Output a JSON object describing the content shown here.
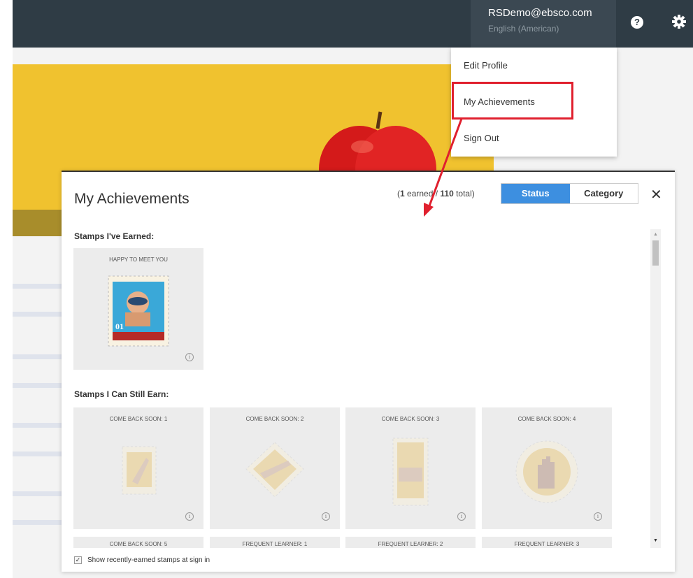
{
  "header": {
    "email": "RSDemo@ebsco.com",
    "language": "English (American)"
  },
  "menu": {
    "items": [
      "Edit Profile",
      "My Achievements",
      "Sign Out"
    ]
  },
  "modal": {
    "title": "My Achievements",
    "earned_count": "1",
    "earned_label": " earned / ",
    "total_count": "110",
    "total_label": " total)",
    "open_paren": "(",
    "tabs": [
      "Status",
      "Category"
    ],
    "close": "✕",
    "earned_heading": "Stamps I've Earned:",
    "earned_stamps": [
      {
        "title": "HAPPY TO MEET YOU",
        "number": "01"
      }
    ],
    "can_earn_heading": "Stamps I Can Still Earn:",
    "available_stamps": [
      {
        "title": "COME BACK SOON: 1"
      },
      {
        "title": "COME BACK SOON: 2"
      },
      {
        "title": "COME BACK SOON: 3"
      },
      {
        "title": "COME BACK SOON: 4"
      },
      {
        "title": "COME BACK SOON: 5"
      },
      {
        "title": "FREQUENT LEARNER: 1"
      },
      {
        "title": "FREQUENT LEARNER: 2"
      },
      {
        "title": "FREQUENT LEARNER: 3"
      }
    ],
    "footer_checkbox": "Show recently-earned stamps at sign in"
  },
  "colors": {
    "topbar": "#2f3c45",
    "accent": "#3d8fe0",
    "highlight": "#e0202e",
    "hero": "#f0c22f"
  }
}
